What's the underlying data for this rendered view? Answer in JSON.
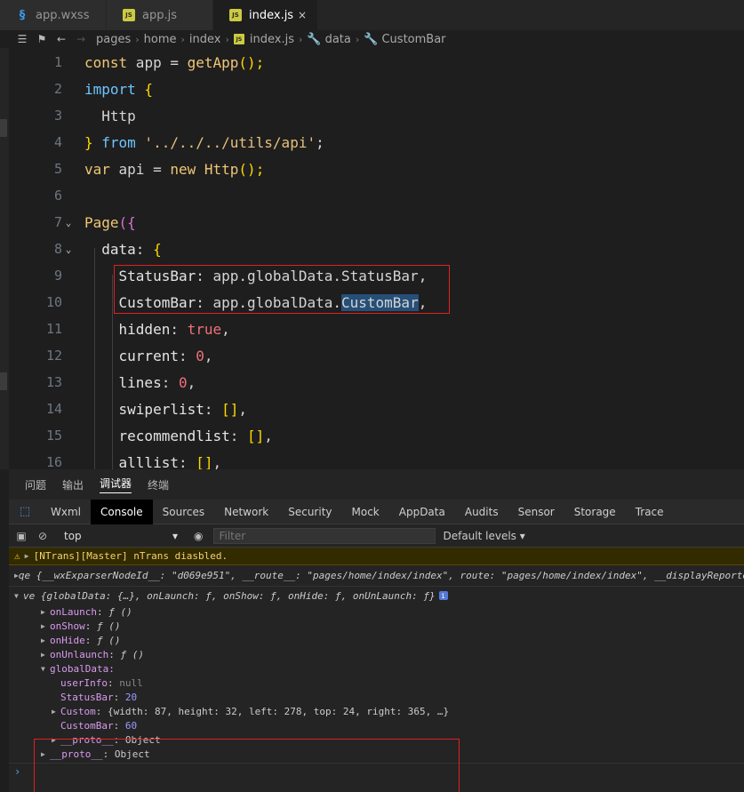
{
  "tabs": [
    {
      "name": "app.wxss",
      "icon": "css-file-icon",
      "glyph": "§",
      "active": false
    },
    {
      "name": "app.js",
      "icon": "js-file-icon",
      "glyph": "JS",
      "active": false
    },
    {
      "name": "index.js",
      "icon": "js-file-icon",
      "glyph": "JS",
      "active": true,
      "close": "×"
    }
  ],
  "breadcrumb": {
    "items": [
      "pages",
      "home",
      "index",
      "index.js",
      "data",
      "CustomBar"
    ],
    "js_badge": "JS"
  },
  "editor": {
    "line_numbers": [
      "1",
      "2",
      "3",
      "4",
      "5",
      "6",
      "7",
      "8",
      "9",
      "10",
      "11",
      "12",
      "13",
      "14",
      "15",
      "16"
    ],
    "lines": {
      "l1": {
        "kw": "const",
        "a": " app = ",
        "fn": "getApp",
        "b": "();"
      },
      "l2": {
        "kw": "import",
        "br": " {"
      },
      "l3": {
        "t": "  Http"
      },
      "l4": {
        "br": "} ",
        "kw": "from",
        "str": " '../../../utils/api'",
        "b": ";"
      },
      "l5": {
        "kw": "var",
        "a": " api = ",
        "kw2": "new",
        "fn": " Http",
        "b": "();"
      },
      "l7": {
        "fn": "Page",
        "br": "({"
      },
      "l8": {
        "p": "data",
        "b": ": ",
        "br": "{"
      },
      "l9": {
        "p": "StatusBar",
        "b": ": app.globalData.StatusBar,"
      },
      "l10": {
        "p": "CustomBar",
        "b": ": app.globalData.",
        "hl": "CustomBar",
        "c": ","
      },
      "l11": {
        "p": "hidden",
        "b": ": ",
        "v": "true",
        "c": ","
      },
      "l12": {
        "p": "current",
        "b": ": ",
        "v": "0",
        "c": ","
      },
      "l13": {
        "p": "lines",
        "b": ": ",
        "v": "0",
        "c": ","
      },
      "l14": {
        "p": "swiperlist",
        "b": ": ",
        "br": "[]",
        "c": ","
      },
      "l15": {
        "p": "recommendlist",
        "b": ": ",
        "br": "[]",
        "c": ","
      },
      "l16": {
        "p": "alllist",
        "b": ": ",
        "br": "[]",
        "c": ","
      }
    }
  },
  "devtools": {
    "top_tabs": [
      "问题",
      "输出",
      "调试器",
      "终端"
    ],
    "panel_tabs": [
      "Wxml",
      "Console",
      "Sources",
      "Network",
      "Security",
      "Mock",
      "AppData",
      "Audits",
      "Sensor",
      "Storage",
      "Trace"
    ],
    "context": "top",
    "filter_placeholder": "Filter",
    "levels": "Default levels ▾",
    "console": {
      "warn": "[NTrans][Master] nTrans diasbled.",
      "qe_line": "qe {__wxExparserNodeId__: \"d069e951\", __route__: \"pages/home/index/index\", route: \"pages/home/index/index\", __displayReporter:",
      "ve_line": "ve {globalData: {…}, onLaunch: ƒ, onShow: ƒ, onHide: ƒ, onUnLaunch: ƒ}",
      "info": "i",
      "methods": [
        {
          "key": "onLaunch",
          "val": "ƒ ()"
        },
        {
          "key": "onShow",
          "val": "ƒ ()"
        },
        {
          "key": "onHide",
          "val": "ƒ ()"
        },
        {
          "key": "onUnlaunch",
          "val": "ƒ ()"
        }
      ],
      "globalData_key": "globalData:",
      "userInfo": {
        "key": "userInfo",
        "val": "null"
      },
      "StatusBar": {
        "key": "StatusBar",
        "val": "20"
      },
      "Custom": {
        "key": "Custom",
        "val": "{width: 87, height: 32, left: 278, top: 24, right: 365, …}"
      },
      "CustomBar": {
        "key": "CustomBar",
        "val": "60"
      },
      "proto_inner": {
        "key": "__proto__",
        "val": "Object"
      },
      "proto_outer": {
        "key": "__proto__",
        "val": "Object"
      },
      "prompt": "›"
    }
  }
}
